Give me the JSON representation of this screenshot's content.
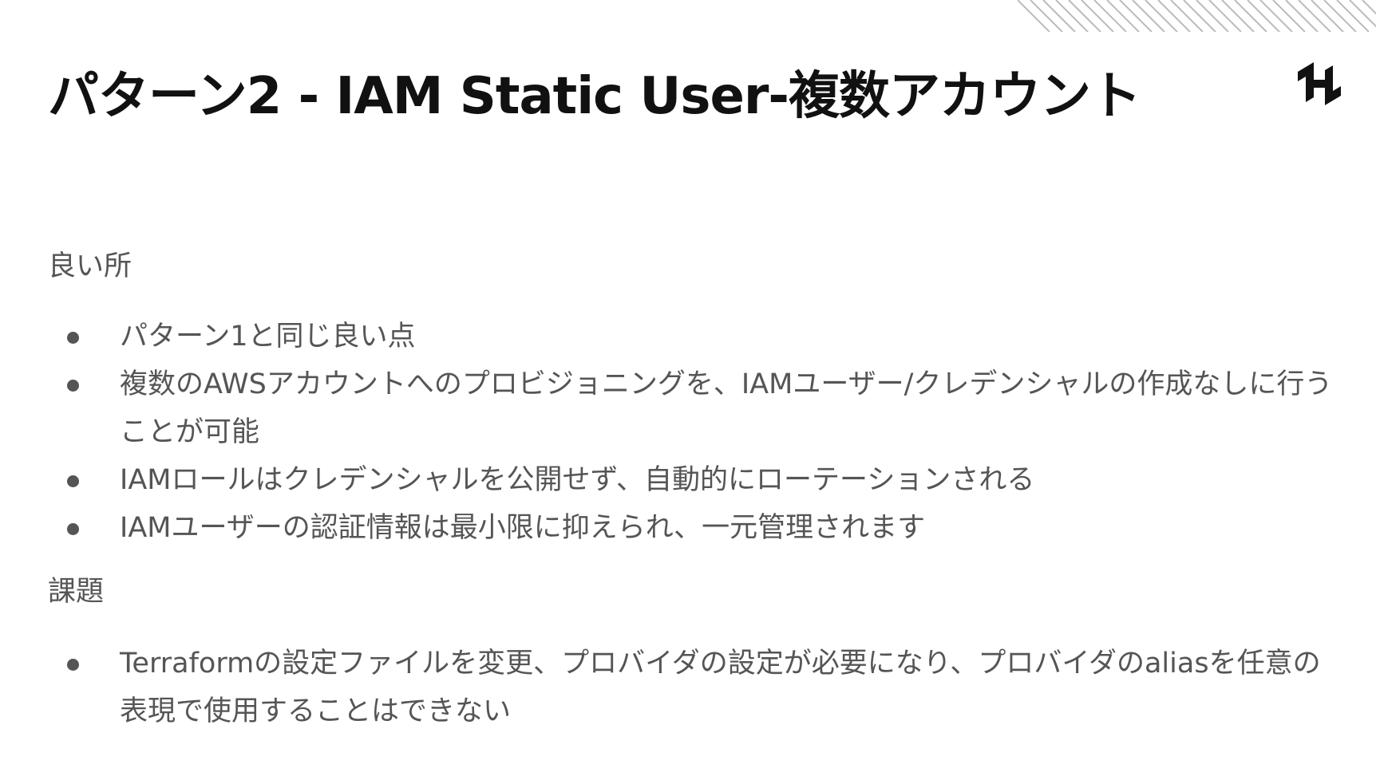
{
  "slide": {
    "title": "パターン2 - IAM Static User-複数アカウント",
    "logo_icon": "hashicorp-logo-icon",
    "stripe_decoration": "diagonal-stripes",
    "colors": {
      "title": "#111111",
      "body": "#555555",
      "background": "#ffffff",
      "stripes": "#bbbbbb"
    }
  },
  "good_points": {
    "heading": "良い所",
    "items": [
      {
        "text": "パターン1と同じ良い点"
      },
      {
        "text": "複数のAWSアカウントへのプロビジョニングを、IAMユーザー/クレデンシャルの作成なしに行うことが可能"
      },
      {
        "text": "IAMロールはクレデンシャルを公開せず、自動的にローテーションされる"
      },
      {
        "text": "IAMユーザーの認証情報は最小限に抑えられ、一元管理されます"
      }
    ]
  },
  "issues": {
    "heading": "課題",
    "items": [
      {
        "text": "Terraformの設定ファイルを変更、プロバイダの設定が必要になり、プロバイダのaliasを任意の表現で使用することはできない"
      }
    ]
  }
}
